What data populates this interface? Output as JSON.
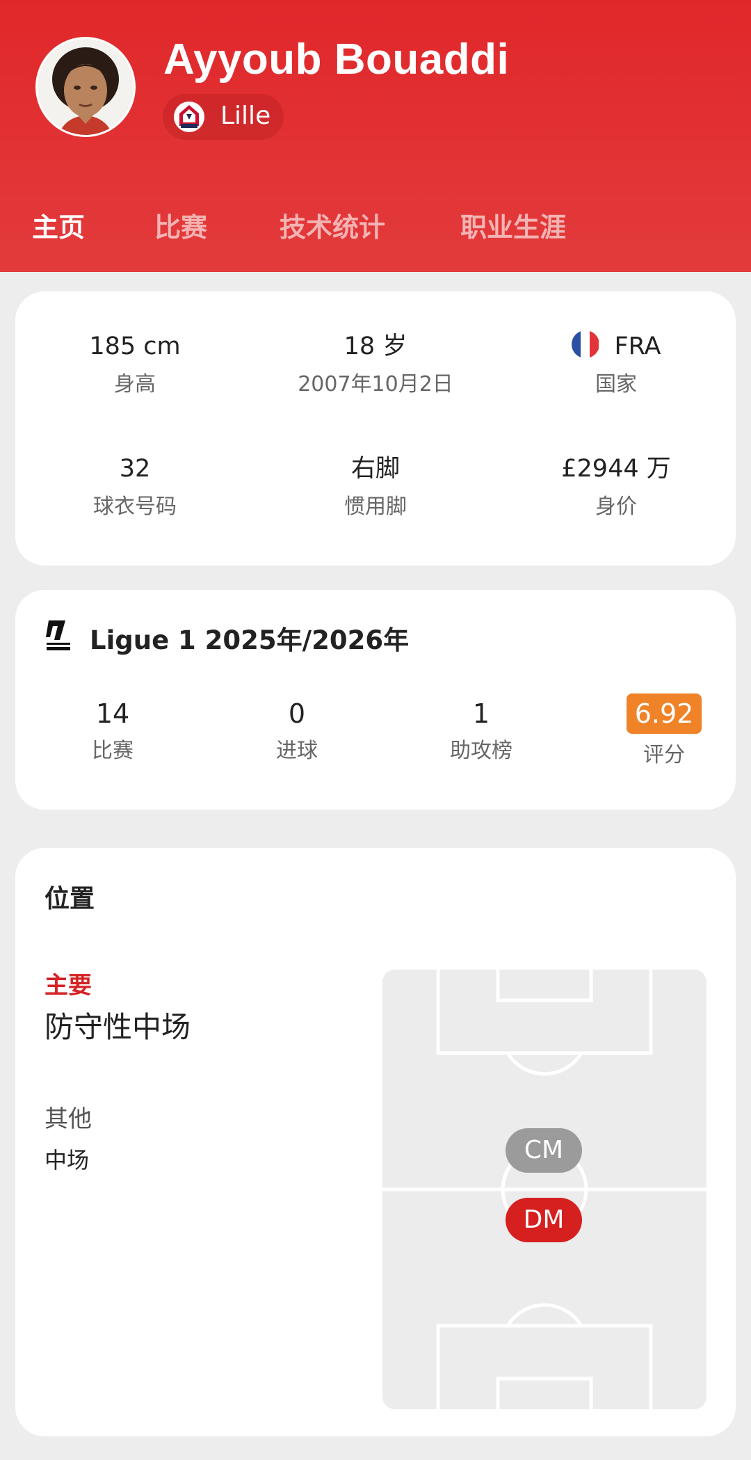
{
  "player": {
    "name": "Ayyoub Bouaddi",
    "club": "Lille",
    "avatar_icon": "player-photo"
  },
  "tabs": [
    {
      "label": "主页",
      "active": true
    },
    {
      "label": "比赛",
      "active": false
    },
    {
      "label": "技术统计",
      "active": false
    },
    {
      "label": "职业生涯",
      "active": false
    }
  ],
  "info": {
    "height": {
      "value": "185 cm",
      "label": "身高"
    },
    "age": {
      "value": "18 岁",
      "label": "2007年10月2日"
    },
    "country": {
      "value": "FRA",
      "label": "国家",
      "flag_colors": [
        "#2b4fa3",
        "#ffffff",
        "#e2343a"
      ]
    },
    "shirt": {
      "value": "32",
      "label": "球衣号码"
    },
    "foot": {
      "value": "右脚",
      "label": "惯用脚"
    },
    "market_value": {
      "value": "£2944 万",
      "label": "身价"
    }
  },
  "league": {
    "title": "Ligue 1 2025年/2026年",
    "logo_icon": "ligue1-logo",
    "stats": [
      {
        "value": "14",
        "label": "比赛"
      },
      {
        "value": "0",
        "label": "进球"
      },
      {
        "value": "1",
        "label": "助攻榜"
      },
      {
        "value": "6.92",
        "label": "评分",
        "badge_color": "#f08228"
      }
    ]
  },
  "position": {
    "title": "位置",
    "main_label": "主要",
    "main_value": "防守性中场",
    "other_label": "其他",
    "other_value": "中场",
    "badges": [
      {
        "label": "CM",
        "color": "#9b9b9b"
      },
      {
        "label": "DM",
        "color": "#d61f1f"
      }
    ]
  },
  "colors": {
    "header_red": "#e1272a",
    "accent_red": "#d42325",
    "rating_orange": "#f08228"
  }
}
